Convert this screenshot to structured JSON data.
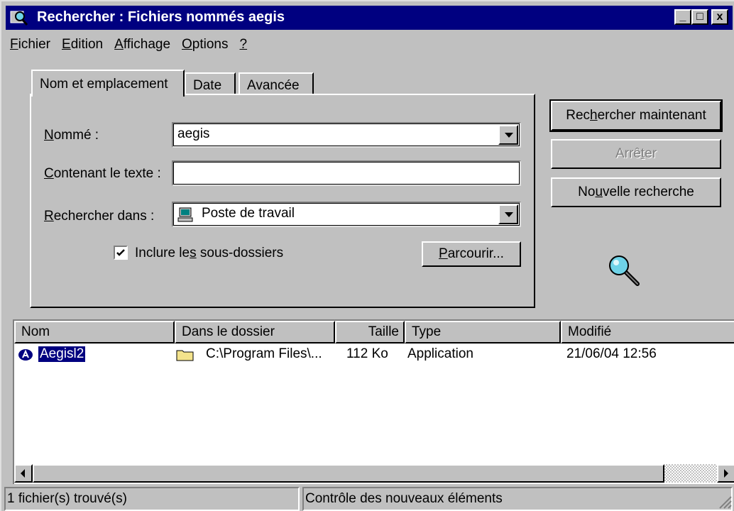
{
  "window": {
    "title": "Rechercher : Fichiers nommés aegis",
    "controls": {
      "minimize": "_",
      "maximize": "□",
      "close": "x"
    }
  },
  "menu": [
    {
      "label": "Fichier",
      "accel": "F",
      "rest": "ichier"
    },
    {
      "label": "Edition",
      "accel": "E",
      "rest": "dition"
    },
    {
      "label": "Affichage",
      "accel": "A",
      "rest": "ffichage"
    },
    {
      "label": "Options",
      "accel": "O",
      "rest": "ptions"
    },
    {
      "label": "?",
      "accel": "?",
      "rest": ""
    }
  ],
  "tabs": [
    "Nom et emplacement",
    "Date",
    "Avancée"
  ],
  "form": {
    "named_label_u": "N",
    "named_label_rest": "ommé :",
    "named_value": "aegis",
    "contains_label_u": "C",
    "contains_label_rest": "ontenant le texte :",
    "contains_value": "",
    "lookin_label_u": "R",
    "lookin_label_rest": "echercher dans :",
    "lookin_value": "Poste de travail",
    "include_pre": "Inclure le",
    "include_u": "s",
    "include_post": " sous-dossiers",
    "include_checked": true,
    "browse_u": "P",
    "browse_rest": "arcourir..."
  },
  "buttons": {
    "search_pre": "Rec",
    "search_u": "h",
    "search_post": "ercher maintenant",
    "stop_pre": "Arrê",
    "stop_u": "t",
    "stop_post": "er",
    "new_pre": "No",
    "new_u": "u",
    "new_post": "velle recherche"
  },
  "results": {
    "columns": [
      "Nom",
      "Dans le dossier",
      "Taille",
      "Type",
      "Modifié"
    ],
    "rows": [
      {
        "name": "Aegisl2",
        "folder": "C:\\Program Files\\...",
        "size": "112 Ko",
        "type": "Application",
        "modified": "21/06/04 12:56"
      }
    ]
  },
  "statusbar": {
    "left": "1 fichier(s) trouvé(s)",
    "right": "Contrôle des nouveaux éléments"
  },
  "colors": {
    "titlebar": "#000080",
    "face": "#c0c0c0",
    "selection": "#000080"
  }
}
